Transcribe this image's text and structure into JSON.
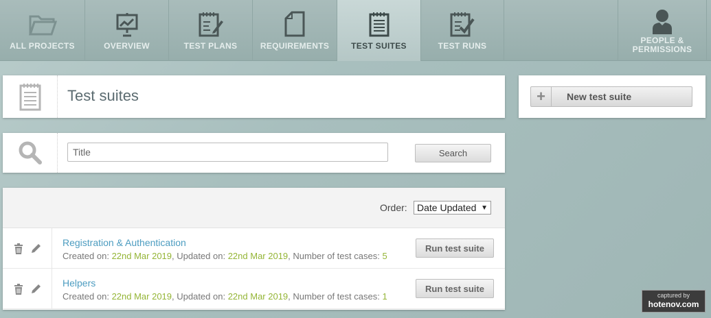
{
  "nav": {
    "items": [
      {
        "label": "ALL PROJECTS",
        "icon": "folder-icon"
      },
      {
        "label": "OVERVIEW",
        "icon": "presentation-board-icon"
      },
      {
        "label": "TEST PLANS",
        "icon": "notepad-pencil-icon"
      },
      {
        "label": "REQUIREMENTS",
        "icon": "document-icon"
      },
      {
        "label": "TEST SUITES",
        "icon": "notepad-list-icon",
        "active": true
      },
      {
        "label": "TEST RUNS",
        "icon": "notepad-check-icon"
      }
    ],
    "people": {
      "line1": "PEOPLE &",
      "line2": "PERMISSIONS",
      "icon": "person-icon"
    }
  },
  "page": {
    "title": "Test suites",
    "new_button": "New test suite"
  },
  "search": {
    "placeholder": "Title",
    "button": "Search"
  },
  "list": {
    "order_label": "Order:",
    "order_value": "Date Updated",
    "rows": [
      {
        "name": "Registration & Authentication",
        "created_label": "Created on:",
        "created": "22nd Mar 2019",
        "updated_label": ", Updated on:",
        "updated": "22nd Mar 2019",
        "count_label": ", Number of test cases:",
        "count": "5",
        "run_label": "Run test suite"
      },
      {
        "name": "Helpers",
        "created_label": "Created on:",
        "created": "22nd Mar 2019",
        "updated_label": ", Updated on:",
        "updated": "22nd Mar 2019",
        "count_label": ", Number of test cases:",
        "count": "1",
        "run_label": "Run test suite"
      }
    ]
  },
  "watermark": {
    "caption": "captured by",
    "brand": "hotenov.com"
  },
  "colors": {
    "link": "#4c9cc0",
    "highlight": "#94b536",
    "nav_label": "#e6eeed"
  }
}
